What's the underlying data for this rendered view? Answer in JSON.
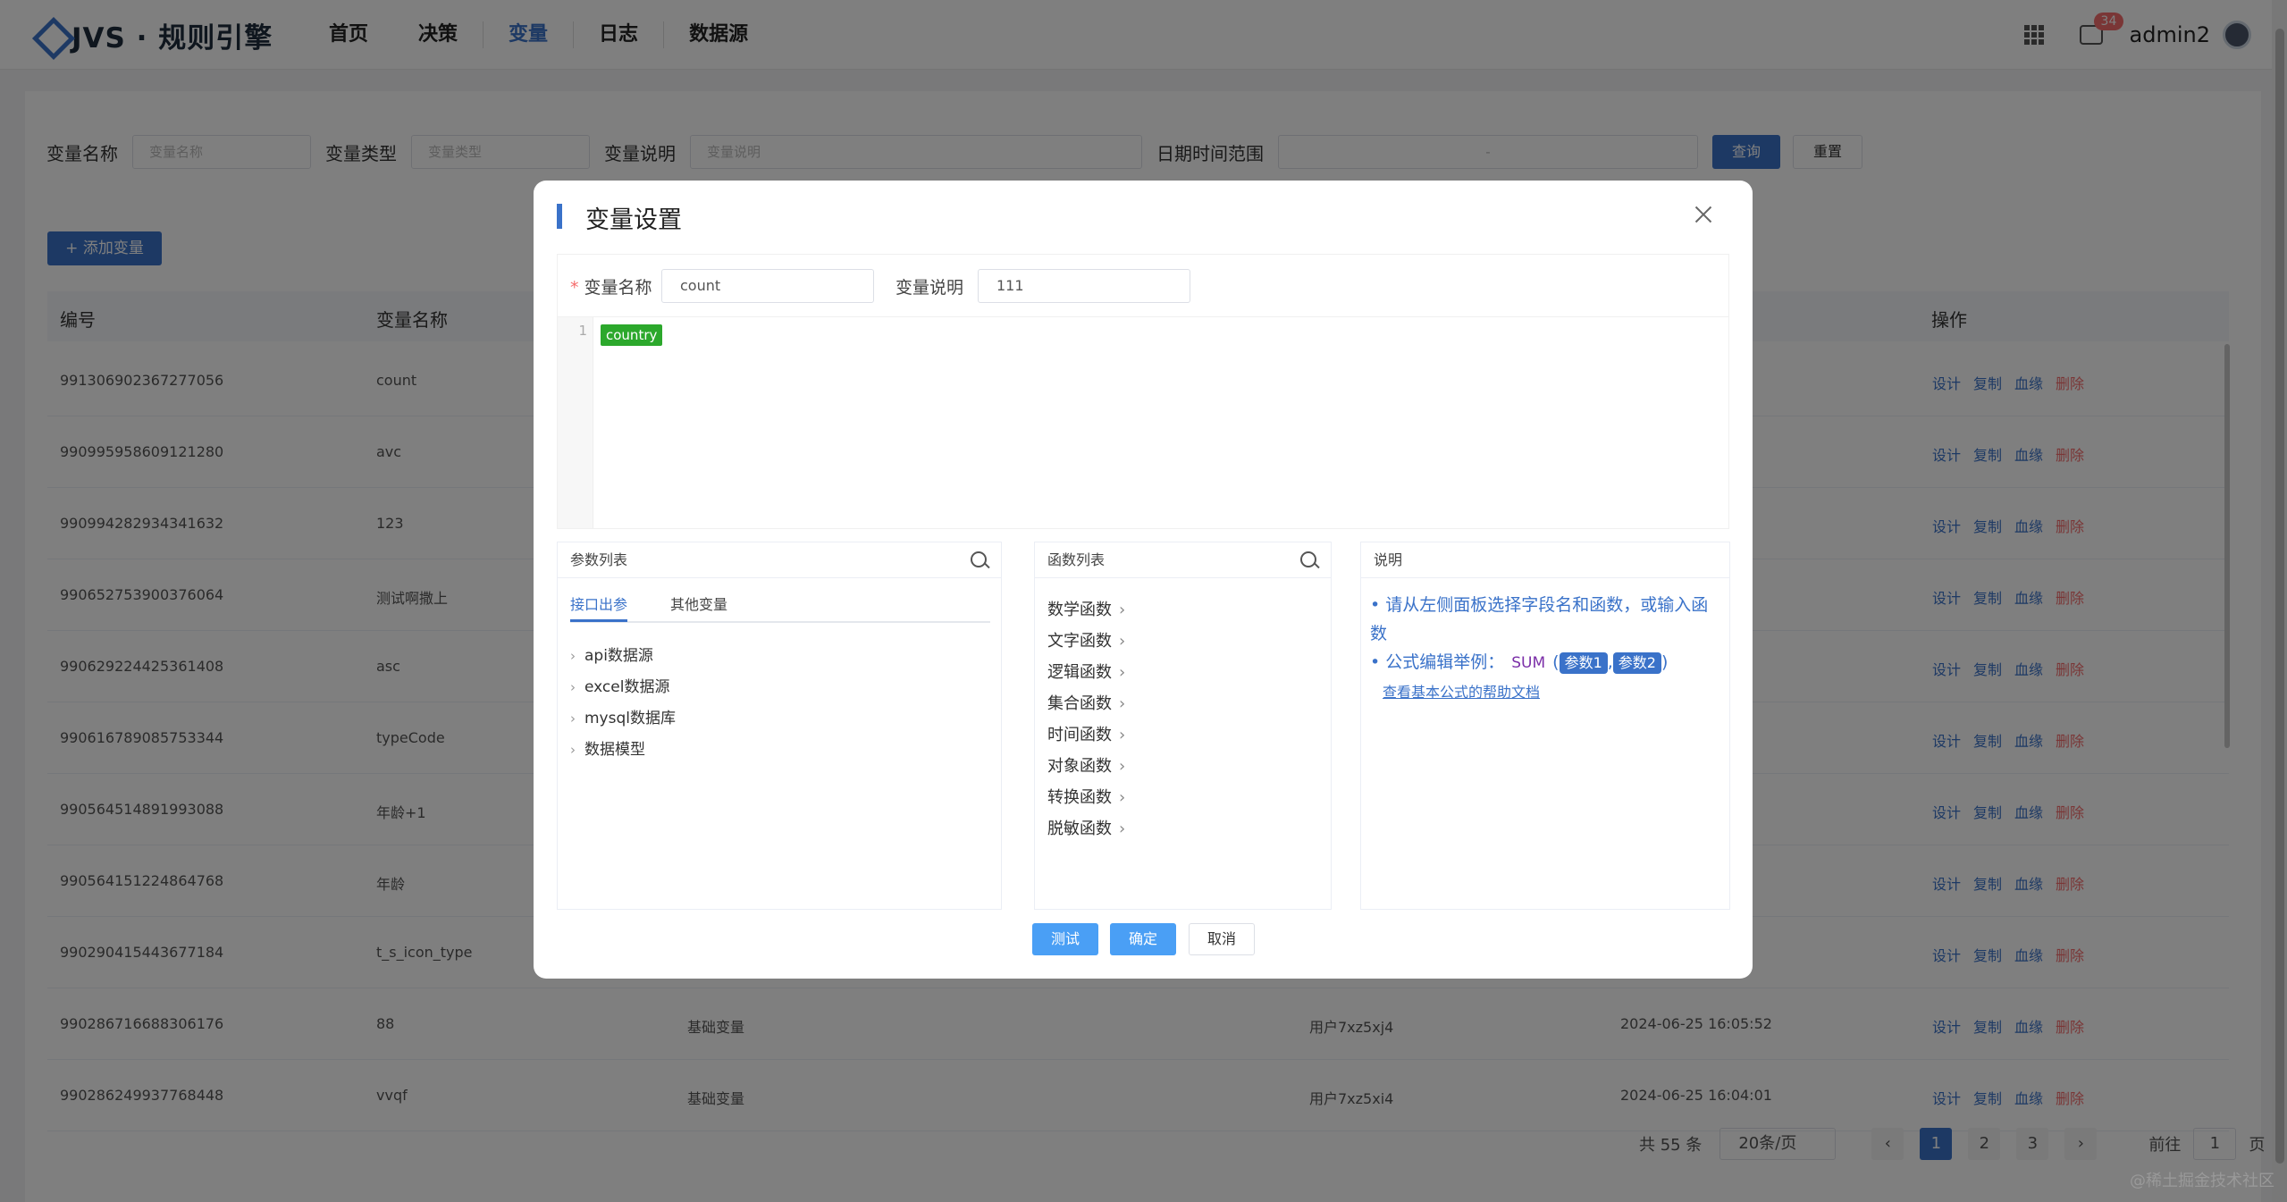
{
  "app": {
    "logo": "JVS · 规则引擎",
    "nav": [
      "首页",
      "决策",
      "变量",
      "日志",
      "数据源"
    ],
    "active_nav": "变量",
    "badge": "34",
    "user": "admin2"
  },
  "filters": {
    "name_label": "变量名称",
    "name_placeholder": "变量名称",
    "type_label": "变量类型",
    "type_placeholder": "变量类型",
    "desc_label": "变量说明",
    "desc_placeholder": "变量说明",
    "date_label": "日期时间范围",
    "date_sep": "-",
    "query": "查询",
    "reset": "重置"
  },
  "add_button": "+ 添加变量",
  "table": {
    "headers": [
      "编号",
      "变量名称",
      "操作"
    ],
    "rows": [
      {
        "id": "991306902367277056",
        "name": "count",
        "type": "",
        "user": "",
        "time": ""
      },
      {
        "id": "990995958609121280",
        "name": "avc",
        "type": "",
        "user": "",
        "time": ""
      },
      {
        "id": "990994282934341632",
        "name": "123",
        "type": "",
        "user": "",
        "time": ""
      },
      {
        "id": "990652753900376064",
        "name": "测试啊撒上",
        "type": "",
        "user": "",
        "time": ""
      },
      {
        "id": "990629224425361408",
        "name": "asc",
        "type": "",
        "user": "",
        "time": ""
      },
      {
        "id": "990616789085753344",
        "name": "typeCode",
        "type": "",
        "user": "",
        "time": ""
      },
      {
        "id": "990564514891993088",
        "name": "年龄+1",
        "type": "",
        "user": "",
        "time": ""
      },
      {
        "id": "990564151224864768",
        "name": "年龄",
        "type": "",
        "user": "",
        "time": ""
      },
      {
        "id": "990290415443677184",
        "name": "t_s_icon_type",
        "type": "",
        "user": "",
        "time": ""
      },
      {
        "id": "990286716688306176",
        "name": "88",
        "type": "基础变量",
        "user": "用户7xz5xj4",
        "time": "2024-06-25 16:05:52"
      },
      {
        "id": "990286249937768448",
        "name": "vvqf",
        "type": "基础变量",
        "user": "用户7xz5xi4",
        "time": "2024-06-25 16:04:01"
      }
    ],
    "ops": [
      "设计",
      "复制",
      "血缘",
      "删除"
    ]
  },
  "pager": {
    "total": "共 55 条",
    "size": "20条/页",
    "pages": [
      "1",
      "2",
      "3"
    ],
    "goto": "前往",
    "page": "1",
    "unit": "页"
  },
  "dialog": {
    "title": "变量设置",
    "name_label": "变量名称",
    "name_value": "count",
    "desc_label": "变量说明",
    "desc_value": "111",
    "line_no": "1",
    "token": "country",
    "params": {
      "title": "参数列表",
      "tabs": [
        "接口出参",
        "其他变量"
      ],
      "items": [
        "api数据源",
        "excel数据源",
        "mysql数据库",
        "数据模型"
      ]
    },
    "funcs": {
      "title": "函数列表",
      "items": [
        "数学函数",
        "文字函数",
        "逻辑函数",
        "集合函数",
        "时间函数",
        "对象函数",
        "转换函数",
        "脱敏函数"
      ]
    },
    "help": {
      "title": "说明",
      "line1": "请从左侧面板选择字段名和函数，或输入函数",
      "line2": "公式编辑举例：",
      "fn": "SUM",
      "p1": "参数1",
      "p2": "参数2",
      "link": "查看基本公式的帮助文档"
    },
    "buttons": {
      "test": "测试",
      "ok": "确定",
      "cancel": "取消"
    }
  },
  "watermark": "@稀土掘金技术社区"
}
